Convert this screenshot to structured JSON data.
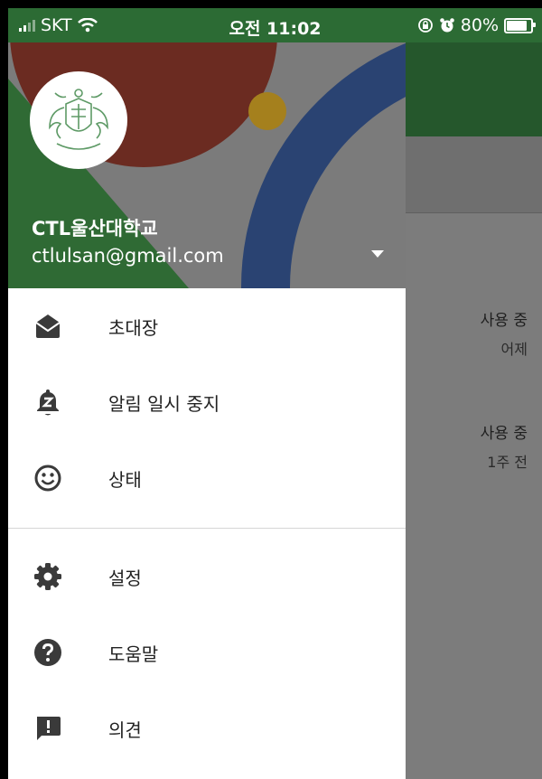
{
  "status_bar": {
    "carrier": "SKT",
    "time": "오전 11:02",
    "battery": "80%",
    "icons": [
      "signal-icon",
      "wifi-icon",
      "orientation-lock-icon",
      "alarm-icon",
      "battery-icon"
    ]
  },
  "account": {
    "name": "CTL울산대학교",
    "email": "ctlulsan@gmail.com",
    "avatar_icon": "university-crest-icon"
  },
  "menu": {
    "group1": [
      {
        "label": "초대장",
        "icon": "envelope-open-icon"
      },
      {
        "label": "알림 일시 중지",
        "icon": "bell-snooze-icon"
      },
      {
        "label": "상태",
        "icon": "smiley-icon"
      }
    ],
    "group2": [
      {
        "label": "설정",
        "icon": "gear-icon"
      },
      {
        "label": "도움말",
        "icon": "help-circle-icon"
      },
      {
        "label": "의견",
        "icon": "feedback-icon"
      }
    ]
  },
  "background_list": [
    {
      "status": "사용 중",
      "time": "어제"
    },
    {
      "status": "사용 중",
      "time": "1주 전"
    }
  ],
  "colors": {
    "status_bar": "#2c6b34",
    "header_red": "#6b2b21",
    "header_blue": "#2a4372",
    "header_green": "#2f6a34",
    "header_gold": "#a5801d",
    "icon_dark": "#3a3a3a"
  }
}
